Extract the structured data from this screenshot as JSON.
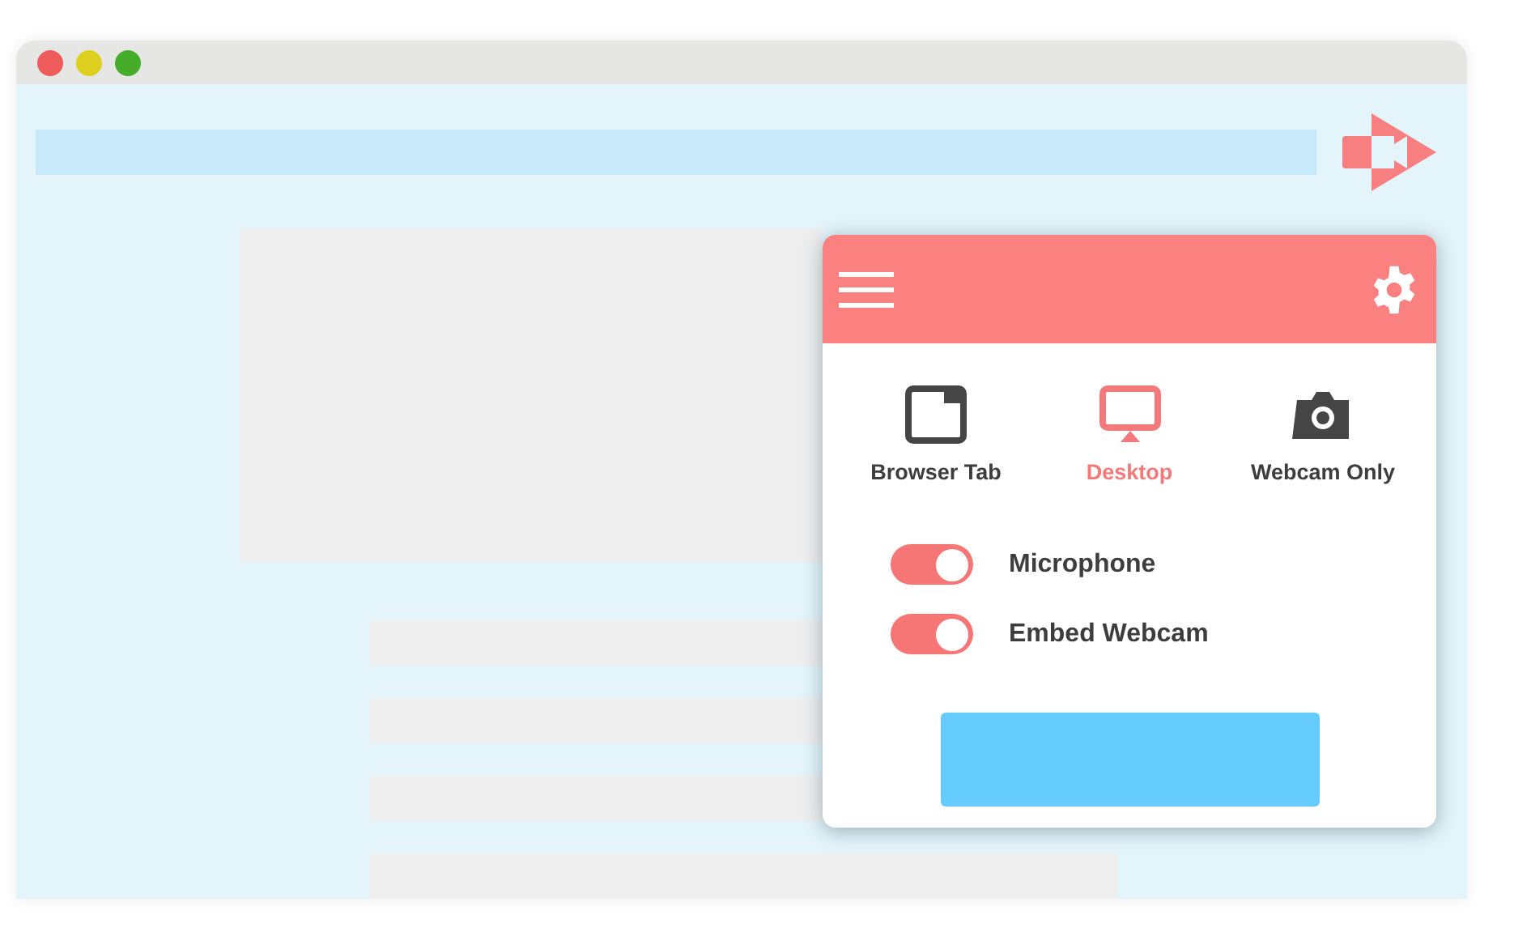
{
  "modes": [
    {
      "label": "Browser Tab",
      "kind": "tab",
      "selected": false
    },
    {
      "label": "Desktop",
      "kind": "desktop",
      "selected": true
    },
    {
      "label": "Webcam Only",
      "kind": "webcam",
      "selected": false
    }
  ],
  "toggles": [
    {
      "label": "Microphone",
      "on": true
    },
    {
      "label": "Embed Webcam",
      "on": true
    }
  ]
}
